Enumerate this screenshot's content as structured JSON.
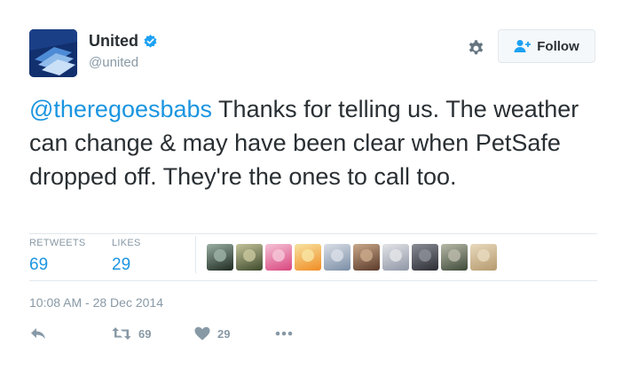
{
  "account": {
    "name": "United",
    "handle": "@united",
    "verified_icon": "verified-badge-icon"
  },
  "header": {
    "follow_label": "Follow",
    "settings_icon": "gear-icon"
  },
  "tweet": {
    "mention": "@theregoesbabs",
    "body": " Thanks for telling us. The weather can change & may have been clear when PetSafe dropped off. They're the ones to call too."
  },
  "stats": {
    "retweets_label": "RETWEETS",
    "retweets_value": "69",
    "likes_label": "LIKES",
    "likes_value": "29"
  },
  "likers": [
    {
      "name": "liker-1",
      "colors": [
        "#1e2a20",
        "#9bb0a4"
      ]
    },
    {
      "name": "liker-2",
      "colors": [
        "#3d4a2c",
        "#c5c49a"
      ]
    },
    {
      "name": "liker-3",
      "colors": [
        "#d9467f",
        "#f5c3d6"
      ]
    },
    {
      "name": "liker-4",
      "colors": [
        "#f08c24",
        "#f7e3a1"
      ]
    },
    {
      "name": "liker-5",
      "colors": [
        "#7b8ea6",
        "#d9dee6"
      ]
    },
    {
      "name": "liker-6",
      "colors": [
        "#5b3a2a",
        "#c9a88a"
      ]
    },
    {
      "name": "liker-7",
      "colors": [
        "#8f96a5",
        "#e3e4e8"
      ]
    },
    {
      "name": "liker-8",
      "colors": [
        "#2c2d33",
        "#8a8d96"
      ]
    },
    {
      "name": "liker-9",
      "colors": [
        "#3e4a38",
        "#b8b9a8"
      ]
    },
    {
      "name": "liker-10",
      "colors": [
        "#b59a6e",
        "#e8d9bd"
      ]
    }
  ],
  "timestamp": "10:08 AM - 28 Dec 2014",
  "actions": {
    "retweet_count": "69",
    "like_count": "29"
  },
  "colors": {
    "link": "#1b95e0",
    "muted": "#8899a6",
    "text": "#292f33"
  }
}
